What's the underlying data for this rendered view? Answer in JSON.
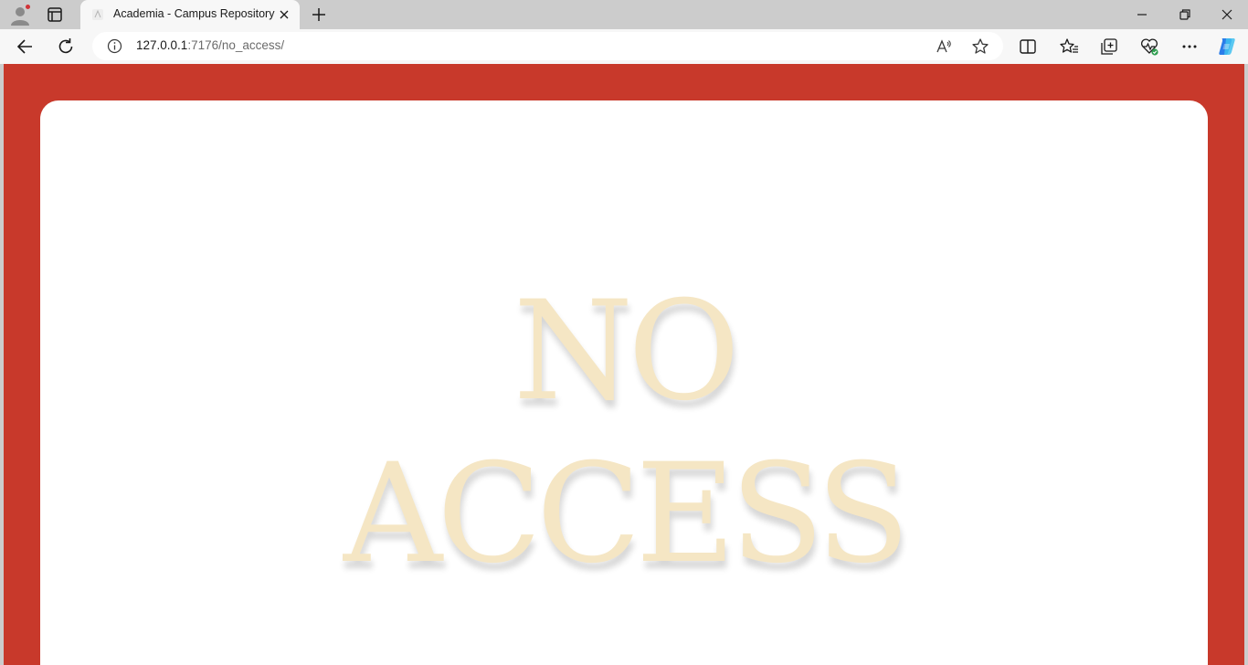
{
  "browser": {
    "tab": {
      "title": "Academia - Campus Repository"
    },
    "address": {
      "host": "127.0.0.1",
      "rest": ":7176/no_access/"
    },
    "icons": {
      "profile": "profile-avatar-icon",
      "tab_actions": "tab-actions-icon",
      "new_tab": "plus-icon",
      "back": "back-arrow-icon",
      "refresh": "refresh-icon",
      "site_info": "info-icon",
      "read_aloud": "read-aloud-icon",
      "favorite": "star-icon",
      "split_screen": "split-screen-icon",
      "favorites": "favorites-icon",
      "collections": "collections-icon",
      "browser_essentials": "heart-pulse-icon",
      "more": "more-dots-icon",
      "copilot": "copilot-icon",
      "minimize": "minimize-icon",
      "restore": "restore-icon",
      "close": "close-icon"
    }
  },
  "page": {
    "message_line1": "NO",
    "message_line2": "ACCESS",
    "colors": {
      "background": "#c8392b",
      "card": "#ffffff",
      "text": "#f5e6c4"
    }
  }
}
